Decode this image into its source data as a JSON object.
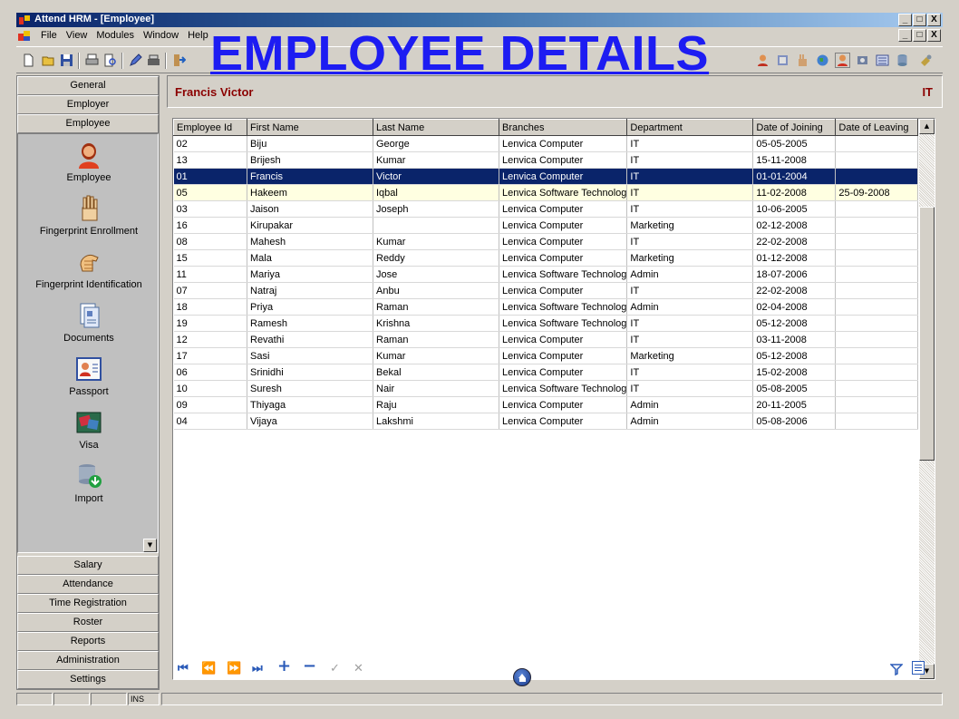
{
  "window": {
    "title": "Attend HRM - [Employee]",
    "controls": [
      "_",
      "□",
      "X"
    ]
  },
  "menu": {
    "items": [
      "File",
      "View",
      "Modules",
      "Window",
      "Help"
    ]
  },
  "banner": "EMPLOYEE DETAILS",
  "sidebar": {
    "top_sections": [
      "General",
      "Employer",
      "Employee"
    ],
    "items": [
      {
        "label": "Employee",
        "icon": "employee-icon"
      },
      {
        "label": "Fingerprint Enrollment",
        "icon": "fingerprint-hand-icon"
      },
      {
        "label": "Fingerprint Identification",
        "icon": "fingerprint-identify-icon"
      },
      {
        "label": "Documents",
        "icon": "documents-icon"
      },
      {
        "label": "Passport",
        "icon": "passport-icon"
      },
      {
        "label": "Visa",
        "icon": "visa-icon"
      },
      {
        "label": "Import",
        "icon": "import-icon"
      }
    ],
    "bottom_sections": [
      "Salary",
      "Attendance",
      "Time Registration",
      "Roster",
      "Reports",
      "Administration",
      "Settings"
    ]
  },
  "employee_header": {
    "name": "Francis Victor",
    "department": "IT"
  },
  "grid": {
    "columns": [
      "Employee Id",
      "First Name",
      "Last Name",
      "Branches",
      "Department",
      "Date of Joining",
      "Date of Leaving"
    ],
    "rows": [
      [
        "02",
        "Biju",
        "George",
        "Lenvica Computer",
        "IT",
        "05-05-2005",
        ""
      ],
      [
        "13",
        "Brijesh",
        "Kumar",
        "Lenvica Computer",
        "IT",
        "15-11-2008",
        ""
      ],
      [
        "01",
        "Francis",
        "Victor",
        "Lenvica Computer",
        "IT",
        "01-01-2004",
        ""
      ],
      [
        "05",
        "Hakeem",
        "Iqbal",
        "Lenvica Software Technolog",
        "IT",
        "11-02-2008",
        "25-09-2008"
      ],
      [
        "03",
        "Jaison",
        "Joseph",
        "Lenvica Computer",
        "IT",
        "10-06-2005",
        ""
      ],
      [
        "16",
        "Kirupakar",
        "",
        "Lenvica Computer",
        "Marketing",
        "02-12-2008",
        ""
      ],
      [
        "08",
        "Mahesh",
        "Kumar",
        "Lenvica Computer",
        "IT",
        "22-02-2008",
        ""
      ],
      [
        "15",
        "Mala",
        "Reddy",
        "Lenvica Computer",
        "Marketing",
        "01-12-2008",
        ""
      ],
      [
        "11",
        "Mariya",
        "Jose",
        "Lenvica Software Technolog",
        "Admin",
        "18-07-2006",
        ""
      ],
      [
        "07",
        "Natraj",
        "Anbu",
        "Lenvica Computer",
        "IT",
        "22-02-2008",
        ""
      ],
      [
        "18",
        "Priya",
        "Raman",
        "Lenvica Software Technolog",
        "Admin",
        "02-04-2008",
        ""
      ],
      [
        "19",
        "Ramesh",
        "Krishna",
        "Lenvica Software Technolog",
        "IT",
        "05-12-2008",
        ""
      ],
      [
        "12",
        "Revathi",
        "Raman",
        "Lenvica Computer",
        "IT",
        "03-11-2008",
        ""
      ],
      [
        "17",
        "Sasi",
        "Kumar",
        "Lenvica Computer",
        "Marketing",
        "05-12-2008",
        ""
      ],
      [
        "06",
        "Srinidhi",
        "Bekal",
        "Lenvica Computer",
        "IT",
        "15-02-2008",
        ""
      ],
      [
        "10",
        "Suresh",
        "Nair",
        "Lenvica Software Technolog",
        "IT",
        "05-08-2005",
        ""
      ],
      [
        "09",
        "Thiyaga",
        "Raju",
        "Lenvica Computer",
        "Admin",
        "20-11-2005",
        ""
      ],
      [
        "04",
        "Vijaya",
        "Lakshmi",
        "Lenvica Computer",
        "Admin",
        "05-08-2006",
        ""
      ]
    ],
    "selected_row": 2,
    "highlighted_row": 3
  },
  "navigator": {
    "buttons": [
      {
        "label": "⏮",
        "icon": "first-record-icon",
        "enabled": true
      },
      {
        "label": "⏪",
        "icon": "prior-record-icon",
        "enabled": true
      },
      {
        "label": "⏩",
        "icon": "next-record-icon",
        "enabled": true
      },
      {
        "label": "⏭",
        "icon": "last-record-icon",
        "enabled": true
      },
      {
        "label": "+",
        "icon": "add-record-icon",
        "enabled": true
      },
      {
        "label": "−",
        "icon": "delete-record-icon",
        "enabled": true
      },
      {
        "label": "✓",
        "icon": "post-record-icon",
        "enabled": false
      },
      {
        "label": "✕",
        "icon": "cancel-record-icon",
        "enabled": false
      }
    ]
  },
  "statusbar": {
    "mode": "INS"
  },
  "colors": {
    "title_bar": "#0a246a",
    "banner": "#1d1cf2",
    "selected_row": "#0a246a",
    "highlight_row": "#ffffe1",
    "header_text": "#8b0000",
    "nav_blue": "#2a5ab8"
  }
}
